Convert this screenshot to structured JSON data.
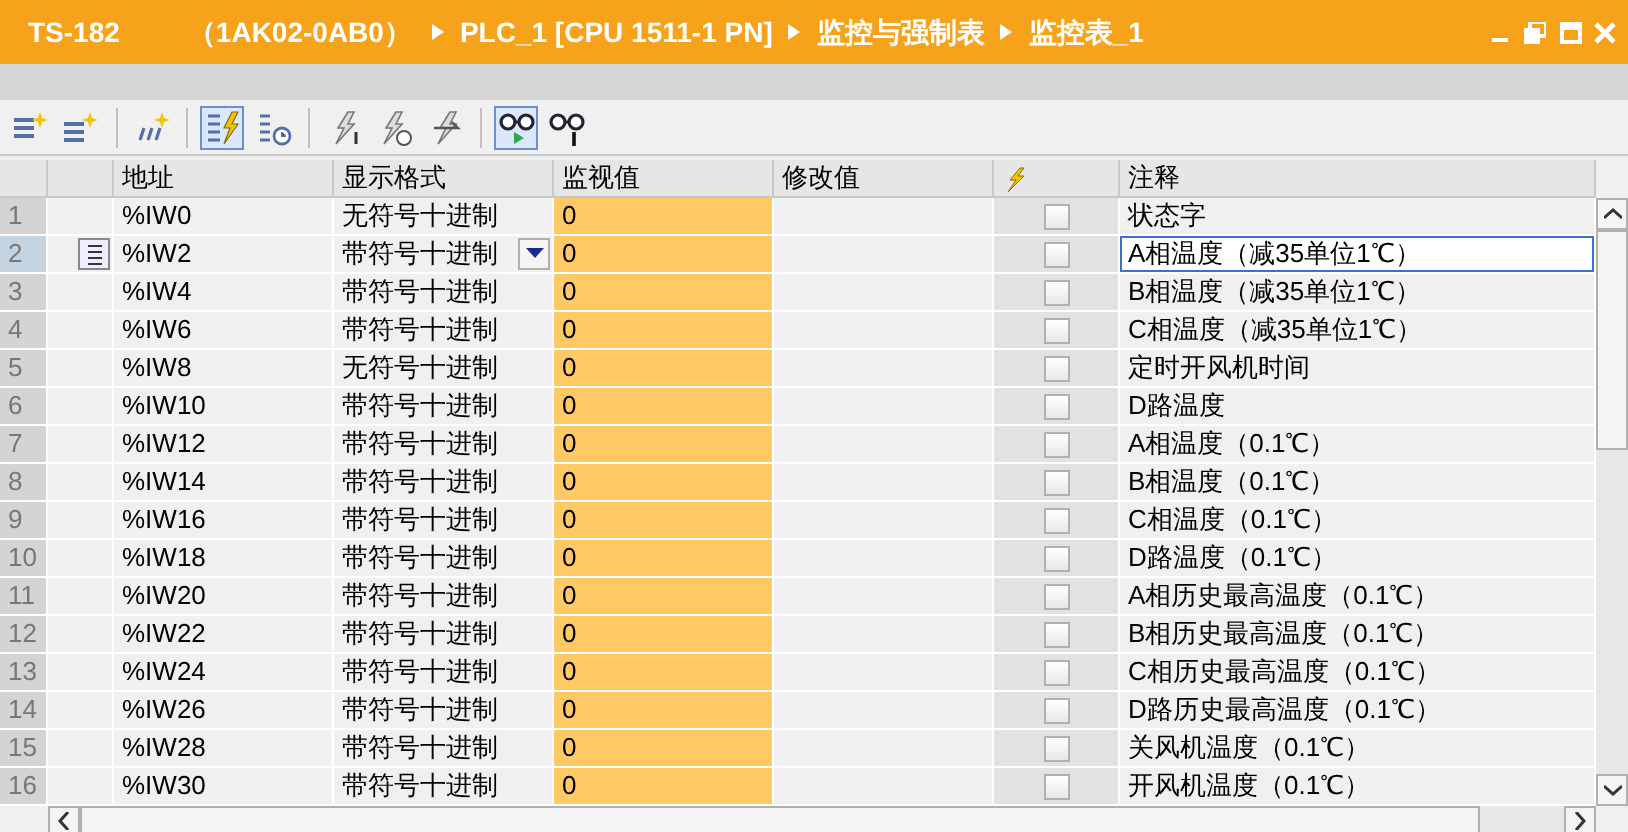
{
  "window": {
    "title_parts": [
      "TS-182",
      "（1AK02-0AB0）",
      "PLC_1 [CPU 1511-1 PN]",
      "监控与强制表",
      "监控表_1"
    ]
  },
  "toolbar": [
    {
      "kind": "insert-row",
      "pressed": false
    },
    {
      "kind": "add-row",
      "pressed": false
    },
    {
      "kind": "add-multi",
      "pressed": false
    },
    {
      "kind": "force-all",
      "pressed": true
    },
    {
      "kind": "monitor-time",
      "pressed": false
    },
    {
      "kind": "modify-once",
      "pressed": false
    },
    {
      "kind": "modify-trigger",
      "pressed": false
    },
    {
      "kind": "modify-enable",
      "pressed": false
    },
    {
      "kind": "monitor-all",
      "pressed": true
    },
    {
      "kind": "monitor-once",
      "pressed": false
    }
  ],
  "table": {
    "columns": [
      "地址",
      "显示格式",
      "监视值",
      "修改值",
      "注释"
    ],
    "rows": [
      {
        "num": "1",
        "address": "%IW0",
        "format": "无符号十进制",
        "value": "0",
        "comment": "状态字",
        "checked": false,
        "selected": false
      },
      {
        "num": "2",
        "address": "%IW2",
        "format": "带符号十进制",
        "value": "0",
        "comment": "A相温度（减35单位1℃）",
        "checked": false,
        "selected": true
      },
      {
        "num": "3",
        "address": "%IW4",
        "format": "带符号十进制",
        "value": "0",
        "comment": "B相温度（减35单位1℃）",
        "checked": false,
        "selected": false
      },
      {
        "num": "4",
        "address": "%IW6",
        "format": "带符号十进制",
        "value": "0",
        "comment": "C相温度（减35单位1℃）",
        "checked": false,
        "selected": false
      },
      {
        "num": "5",
        "address": "%IW8",
        "format": "无符号十进制",
        "value": "0",
        "comment": "定时开风机时间",
        "checked": false,
        "selected": false
      },
      {
        "num": "6",
        "address": "%IW10",
        "format": "带符号十进制",
        "value": "0",
        "comment": "D路温度",
        "checked": false,
        "selected": false
      },
      {
        "num": "7",
        "address": "%IW12",
        "format": "带符号十进制",
        "value": "0",
        "comment": "A相温度（0.1℃）",
        "checked": false,
        "selected": false
      },
      {
        "num": "8",
        "address": "%IW14",
        "format": "带符号十进制",
        "value": "0",
        "comment": "B相温度（0.1℃）",
        "checked": false,
        "selected": false
      },
      {
        "num": "9",
        "address": "%IW16",
        "format": "带符号十进制",
        "value": "0",
        "comment": "C相温度（0.1℃）",
        "checked": false,
        "selected": false
      },
      {
        "num": "10",
        "address": "%IW18",
        "format": "带符号十进制",
        "value": "0",
        "comment": "D路温度（0.1℃）",
        "checked": false,
        "selected": false
      },
      {
        "num": "11",
        "address": "%IW20",
        "format": "带符号十进制",
        "value": "0",
        "comment": "A相历史最高温度（0.1℃）",
        "checked": false,
        "selected": false
      },
      {
        "num": "12",
        "address": "%IW22",
        "format": "带符号十进制",
        "value": "0",
        "comment": "B相历史最高温度（0.1℃）",
        "checked": false,
        "selected": false
      },
      {
        "num": "13",
        "address": "%IW24",
        "format": "带符号十进制",
        "value": "0",
        "comment": "C相历史最高温度（0.1℃）",
        "checked": false,
        "selected": false
      },
      {
        "num": "14",
        "address": "%IW26",
        "format": "带符号十进制",
        "value": "0",
        "comment": "D路历史最高温度（0.1℃）",
        "checked": false,
        "selected": false
      },
      {
        "num": "15",
        "address": "%IW28",
        "format": "带符号十进制",
        "value": "0",
        "comment": "关风机温度（0.1℃）",
        "checked": false,
        "selected": false
      },
      {
        "num": "16",
        "address": "%IW30",
        "format": "带符号十进制",
        "value": "0",
        "comment": "开风机温度（0.1℃）",
        "checked": false,
        "selected": false
      }
    ]
  }
}
